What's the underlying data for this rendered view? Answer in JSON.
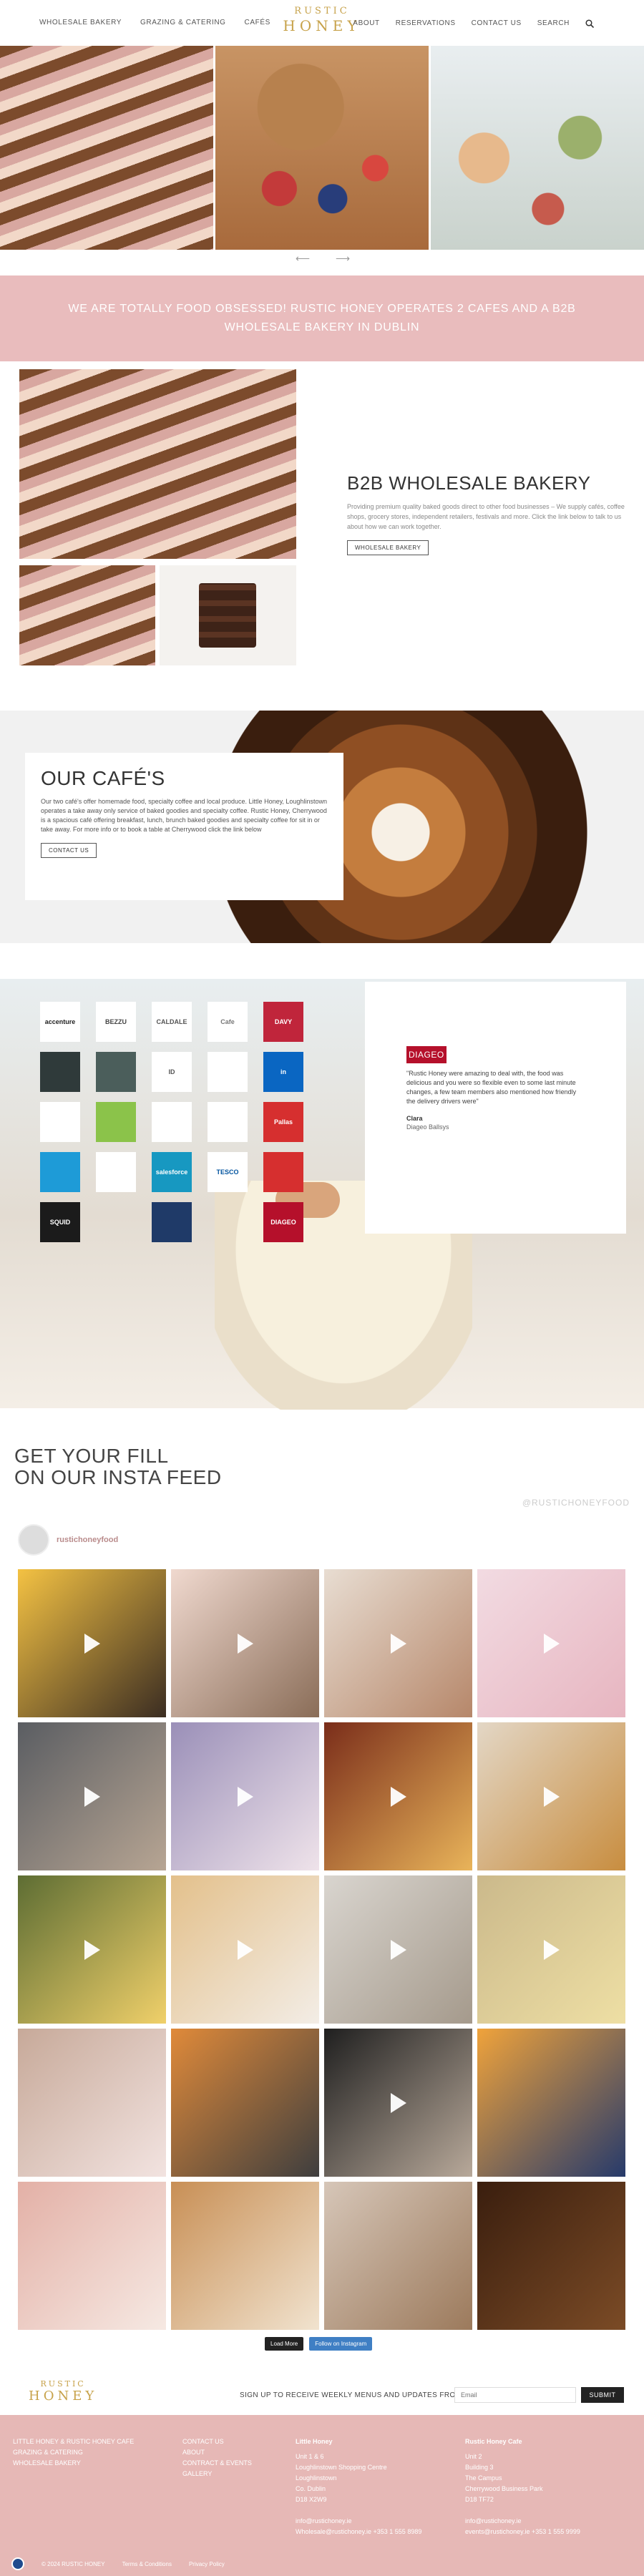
{
  "header": {
    "logo_top": "RUSTIC",
    "logo_bottom": "HONEY",
    "nav_left": [
      "WHOLESALE BAKERY",
      "GRAZING & CATERING",
      "CAFÉS"
    ],
    "nav_right": [
      "ABOUT",
      "RESERVATIONS",
      "CONTACT US",
      "SEARCH"
    ]
  },
  "hero": {
    "prev": "⟵",
    "next": "⟶"
  },
  "banner": {
    "text": "WE ARE TOTALLY FOOD OBSESSED! RUSTIC HONEY OPERATES 2 CAFES AND A B2B WHOLESALE BAKERY IN DUBLIN"
  },
  "wholesale": {
    "title": "B2B WHOLESALE BAKERY",
    "body": "Providing premium quality baked goods direct to other food businesses – We supply cafés, coffee shops, grocery stores, independent retailers, festivals and more. Click the link below to talk to us about how we can work together.",
    "button": "WHOLESALE BAKERY"
  },
  "cafes": {
    "title": "OUR CAFÉ'S",
    "body": "Our two café's offer homemade food, specialty coffee and local produce. Little Honey, Loughlinstown operates a take away only service of baked goodies and specialty coffee. Rustic Honey, Cherrywood is a spacious café offering breakfast, lunch, brunch baked goodies and specialty coffee for sit in or take away. For more info or to book a table at Cherrywood click the link below",
    "button": "CONTACT US"
  },
  "clients": {
    "logos": [
      {
        "text": "accenture",
        "bg": "#ffffff",
        "fg": "#222222"
      },
      {
        "text": "BEZZU",
        "bg": "#ffffff",
        "fg": "#444444"
      },
      {
        "text": "CALDALE",
        "bg": "#ffffff",
        "fg": "#555555"
      },
      {
        "text": "Cafe",
        "bg": "#ffffff",
        "fg": "#777777"
      },
      {
        "text": "DAVY",
        "bg": "#c0253b",
        "fg": "#ffffff"
      },
      {
        "text": "",
        "bg": "#2f3a3a",
        "fg": "#ffffff"
      },
      {
        "text": "",
        "bg": "#4b5e5b",
        "fg": "#ffffff"
      },
      {
        "text": "ID",
        "bg": "#ffffff",
        "fg": "#555555"
      },
      {
        "text": "",
        "bg": "#ffffff",
        "fg": "#3c8a3c"
      },
      {
        "text": "in",
        "bg": "#0a66c2",
        "fg": "#ffffff"
      },
      {
        "text": "",
        "bg": "#ffffff",
        "fg": "#333333"
      },
      {
        "text": "",
        "bg": "#8bc34a",
        "fg": "#ffffff"
      },
      {
        "text": "",
        "bg": "#ffffff",
        "fg": "#333333"
      },
      {
        "text": "",
        "bg": "#ffffff",
        "fg": "#c33333"
      },
      {
        "text": "Pallas",
        "bg": "#d62f2f",
        "fg": "#ffffff"
      },
      {
        "text": "",
        "bg": "#1e9bd7",
        "fg": "#ffffff"
      },
      {
        "text": "",
        "bg": "#ffffff",
        "fg": "#222222"
      },
      {
        "text": "salesforce",
        "bg": "#1798c1",
        "fg": "#ffffff"
      },
      {
        "text": "TESCO",
        "bg": "#ffffff",
        "fg": "#00539f"
      },
      {
        "text": "",
        "bg": "#d62f2f",
        "fg": "#ffffff"
      },
      {
        "text": "SQUID",
        "bg": "#1b1b1b",
        "fg": "#ffffff"
      },
      {
        "text": "",
        "bg": "transparent",
        "fg": "#ffffff"
      },
      {
        "text": "",
        "bg": "#1f3a68",
        "fg": "#ffffff"
      },
      {
        "text": "",
        "bg": "transparent",
        "fg": "#ffffff"
      },
      {
        "text": "DIAGEO",
        "bg": "#b5102b",
        "fg": "#ffffff"
      }
    ],
    "testimonial": {
      "brand": "DIAGEO",
      "quote": "\"Rustic Honey were amazing to deal with, the food was delicious and you were so flexible even to some last minute changes, a few team members also mentioned how friendly the delivery drivers were\"",
      "name": "Clara",
      "org": "Diageo Ballsys"
    }
  },
  "insta": {
    "title_line1": "GET YOUR FILL",
    "title_line2": "ON OUR INSTA FEED",
    "handle": "@RUSTICHONEYFOOD",
    "profile": "rustichoneyfood",
    "tiles": [
      {
        "c1": "#f4c243",
        "c2": "#3b2d22",
        "play": true
      },
      {
        "c1": "#f0d9cf",
        "c2": "#8a6d58",
        "play": true
      },
      {
        "c1": "#e8ddd2",
        "c2": "#b6876a",
        "play": true
      },
      {
        "c1": "#f2dbe2",
        "c2": "#e7b5c0",
        "play": true
      },
      {
        "c1": "#5a5d62",
        "c2": "#b7a593",
        "play": true
      },
      {
        "c1": "#9a8fb8",
        "c2": "#efe3ea",
        "play": true
      },
      {
        "c1": "#7a2d1a",
        "c2": "#e9b45a",
        "play": true
      },
      {
        "c1": "#e3d7c6",
        "c2": "#c88d3f",
        "play": true
      },
      {
        "c1": "#5d6d33",
        "c2": "#f0d06a",
        "play": true
      },
      {
        "c1": "#e3c08b",
        "c2": "#f3ede6",
        "play": true
      },
      {
        "c1": "#d9d5cf",
        "c2": "#a59a8c",
        "play": true
      },
      {
        "c1": "#cbb98b",
        "c2": "#eedfa4",
        "play": true
      },
      {
        "c1": "#c7a999",
        "c2": "#f2e3e0",
        "play": false
      },
      {
        "c1": "#e08a3a",
        "c2": "#3e3e3e",
        "play": false
      },
      {
        "c1": "#1f1f1f",
        "c2": "#b8a99a",
        "play": true
      },
      {
        "c1": "#f0a33b",
        "c2": "#263a6b",
        "play": false
      },
      {
        "c1": "#e3b0a6",
        "c2": "#f6e9e3",
        "play": false
      },
      {
        "c1": "#c88f55",
        "c2": "#f1e3cf",
        "play": false
      },
      {
        "c1": "#d6c6b8",
        "c2": "#9c7a5c",
        "play": false
      },
      {
        "c1": "#3a1e0e",
        "c2": "#7b4b26",
        "play": false
      }
    ],
    "load_more": "Load More",
    "follow": "Follow on Instagram"
  },
  "newsletter": {
    "text": "SIGN UP TO RECEIVE WEEKLY MENUS AND UPDATES FROM US",
    "placeholder": "Email",
    "button": "SUBMIT"
  },
  "footer": {
    "col1": [
      "LITTLE HONEY & RUSTIC HONEY CAFE",
      "GRAZING & CATERING",
      "WHOLESALE BAKERY"
    ],
    "col2": [
      "CONTACT US",
      "ABOUT",
      "CONTRACT & EVENTS",
      "GALLERY"
    ],
    "col3_title": "Little Honey",
    "col3": [
      "Unit 1 & 6",
      "Loughlinstown Shopping Centre",
      "Loughlinstown",
      "Co. Dublin",
      "D18 X2W9",
      "",
      "info@rustichoney.ie",
      "Wholesale@rustichoney.ie  +353 1 555 8989"
    ],
    "col4_title": "Rustic Honey Cafe",
    "col4": [
      "Unit 2",
      "Building 3",
      "The Campus",
      "Cherrywood Business Park",
      "D18 TF72",
      "",
      "info@rustichoney.ie",
      "events@rustichoney.ie  +353 1 555 9999"
    ],
    "copyright": "© 2024 RUSTIC HONEY",
    "terms": "Terms & Conditions",
    "privacy": "Privacy Policy"
  },
  "colors": {
    "gold": "#c7a24a",
    "pink": "#e9bcbd",
    "footer_pink": "#e6b8b6"
  }
}
